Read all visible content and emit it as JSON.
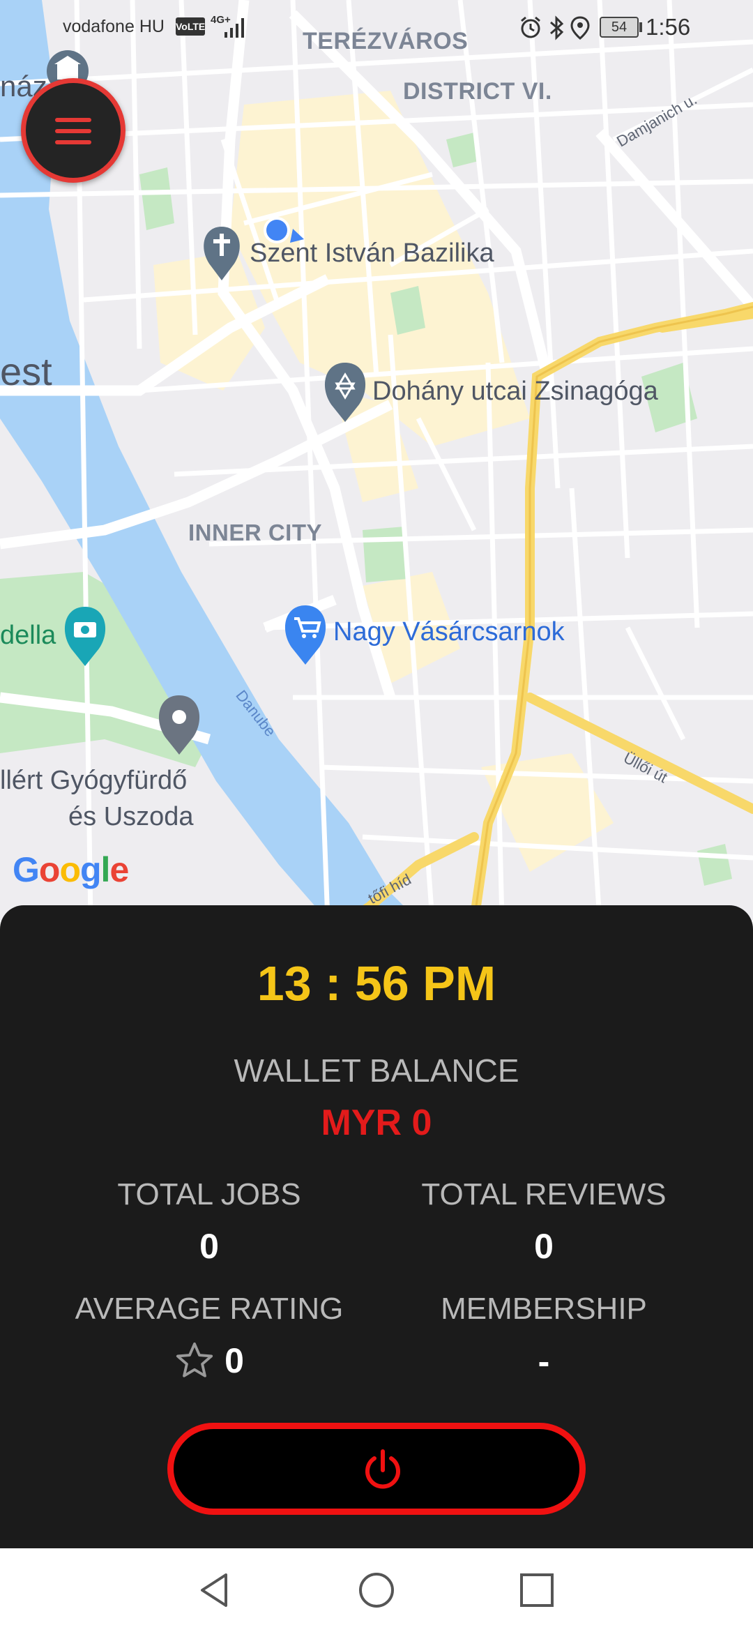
{
  "status_bar": {
    "carrier": "vodafone HU",
    "volte": "VoLTE",
    "network": "4G+",
    "battery": "54",
    "time": "1:56",
    "icons": [
      "alarm-icon",
      "bluetooth-icon",
      "location-icon"
    ]
  },
  "map": {
    "labels": {
      "terezvaros": "TERÉZVÁROS",
      "district": "DISTRICT VI.",
      "damjanich": "Damjanich u.",
      "bazilika": "Szent István Bazilika",
      "zsinagoga": "Dohány utcai Zsinagóga",
      "inner_city": "INNER CITY",
      "vasarcsarnok": "Nagy Vásárcsarnok",
      "budapest_partial": "est",
      "haz_partial": "náz",
      "della_partial": "della",
      "gellert_line1": "llért Gyógyfürdő",
      "gellert_line2": "és Uszoda",
      "danube": "Danube",
      "ulloi": "Üllői út",
      "petofi": "tőfi híd"
    },
    "logo": "Google",
    "colors": {
      "land": "#eeedf0",
      "water": "#a9d2f7",
      "park": "#c5e8c3",
      "arterial": "#f8d86a",
      "built": "#fdf3d2"
    }
  },
  "menu": {
    "icon": "hamburger-icon",
    "accent": "#e53935"
  },
  "panel": {
    "clock": "13 : 56 PM",
    "wallet_label": "WALLET BALANCE",
    "wallet_value": "MYR 0",
    "total_jobs_label": "TOTAL JOBS",
    "total_jobs_value": "0",
    "total_reviews_label": "TOTAL REVIEWS",
    "total_reviews_value": "0",
    "avg_rating_label": "AVERAGE RATING",
    "avg_rating_value": "0",
    "membership_label": "MEMBERSHIP",
    "membership_value": "-",
    "power_icon": "power-icon",
    "colors": {
      "clock": "#f5c518",
      "wallet": "#e31b1b",
      "power": "#f01111",
      "panel_bg": "#1b1b1b"
    }
  },
  "nav_bar": {
    "back": "back-icon",
    "home": "home-icon",
    "recents": "recents-icon"
  }
}
